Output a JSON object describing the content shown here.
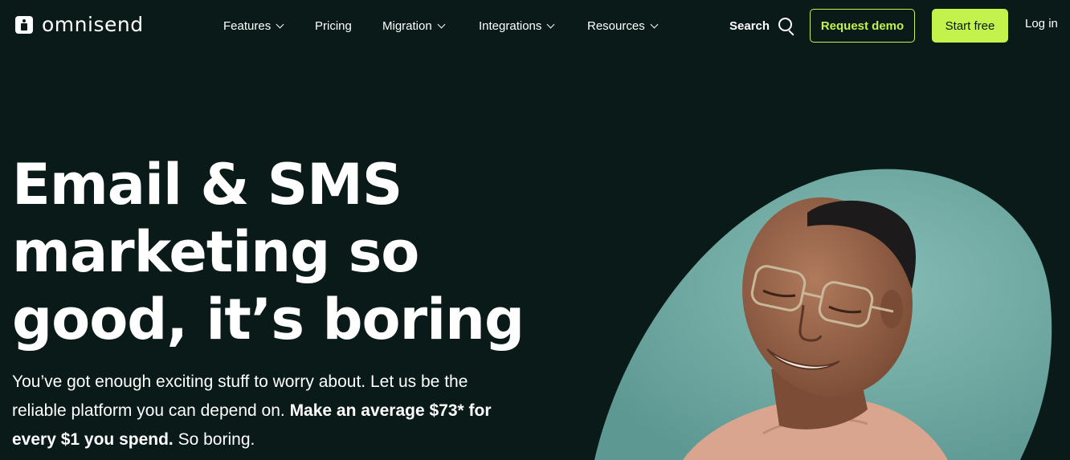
{
  "nav": {
    "logo_text": "omnisend",
    "items": [
      {
        "label": "Features",
        "has_dropdown": true
      },
      {
        "label": "Pricing",
        "has_dropdown": false
      },
      {
        "label": "Migration",
        "has_dropdown": true
      },
      {
        "label": "Integrations",
        "has_dropdown": true
      },
      {
        "label": "Resources",
        "has_dropdown": true
      }
    ],
    "search_label": "Search",
    "request_demo_label": "Request demo",
    "start_free_label": "Start free",
    "login_label": "Log in"
  },
  "hero": {
    "headline_lines": [
      "Email & SMS",
      "marketing so",
      "good, it’s boring"
    ],
    "sub_regular": "You’ve got enough exciting stuff to worry about. Let us be the reliable platform you can depend on. ",
    "sub_bold": "Make an average $73* for every $1 you spend.",
    "sub_tail": " So boring."
  },
  "colors": {
    "background": "#0a1a18",
    "accent": "#c2f24b",
    "photo_bg": "#6fa8a2"
  },
  "icons": [
    "logo-icon",
    "chevron-down-icon",
    "search-icon"
  ]
}
